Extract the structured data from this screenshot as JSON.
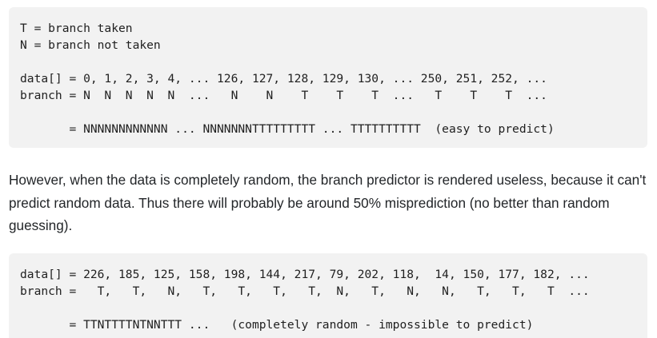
{
  "code_block_1": {
    "lines": [
      "T = branch taken",
      "N = branch not taken",
      "",
      "data[] = 0, 1, 2, 3, 4, ... 126, 127, 128, 129, 130, ... 250, 251, 252, ...",
      "branch = N  N  N  N  N  ...   N    N    T    T    T  ...   T    T    T  ...",
      "",
      "       = NNNNNNNNNNNN ... NNNNNNNTTTTTTTTT ... TTTTTTTTTT  (easy to predict)"
    ]
  },
  "paragraph": {
    "text": "However, when the data is completely random, the branch predictor is rendered useless, because it can't predict random data. Thus there will probably be around 50% misprediction (no better than random guessing)."
  },
  "code_block_2": {
    "lines": [
      "data[] = 226, 185, 125, 158, 198, 144, 217, 79, 202, 118,  14, 150, 177, 182, ...",
      "branch =   T,   T,   N,   T,   T,   T,   T,  N,   T,   N,   N,   T,   T,   T  ...",
      "",
      "       = TTNTTTTNTNNTTT ...   (completely random - impossible to predict)"
    ]
  }
}
